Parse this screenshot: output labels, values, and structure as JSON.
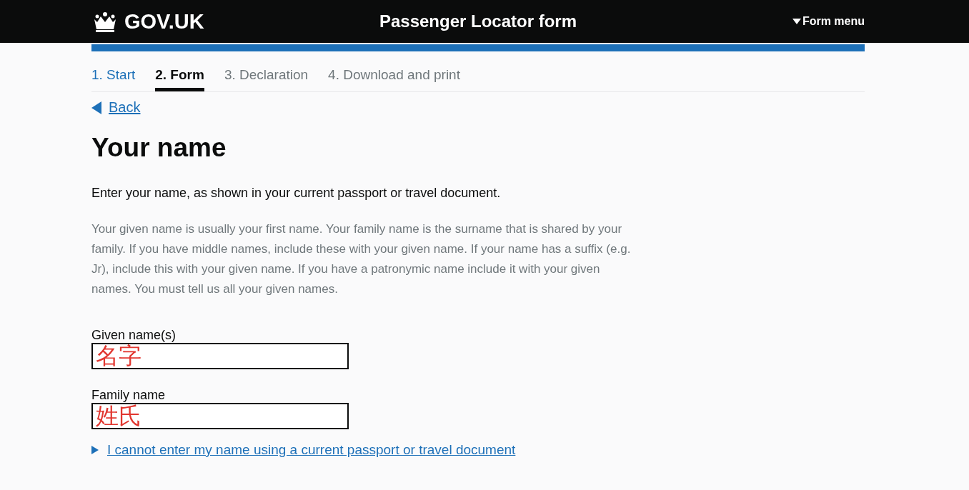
{
  "header": {
    "logo": "GOV.UK",
    "title": "Passenger Locator form",
    "menu": "Form menu"
  },
  "steps": [
    {
      "label": "1. Start",
      "selected": false,
      "done": true
    },
    {
      "label": "2. Form",
      "selected": true,
      "done": false
    },
    {
      "label": "3. Declaration",
      "selected": false,
      "done": false
    },
    {
      "label": "4. Download and print",
      "selected": false,
      "done": false
    }
  ],
  "back": "Back",
  "heading": "Your name",
  "intro": "Enter your name, as shown in your current passport or travel document.",
  "hint": "Your given name is usually your first name. Your family name is the surname that is shared by your family. If you have middle names, include these with your given name. If your name has a suffix (e.g. Jr), include this with your given name. If you have a patronymic name include it with your given names. You must tell us all your given names.",
  "fields": [
    {
      "label": "Given name(s)",
      "annotation": "名字"
    },
    {
      "label": "Family name",
      "annotation": "姓氏"
    }
  ],
  "details_link": "I cannot enter my name using a current passport or travel document"
}
